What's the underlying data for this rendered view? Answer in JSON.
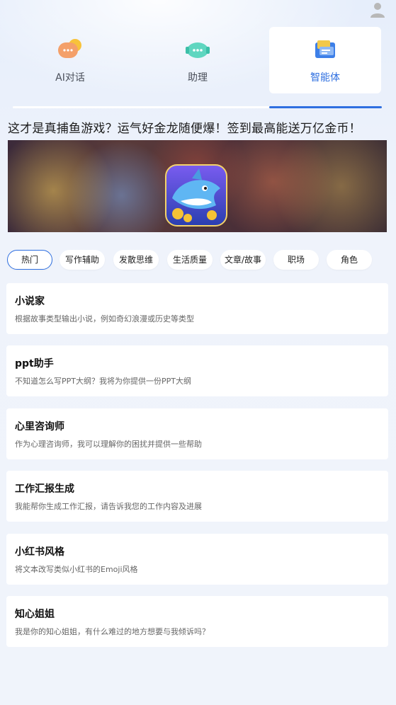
{
  "tabs": [
    {
      "label": "AI对话",
      "icon": "chat-bubble-icon",
      "active": false
    },
    {
      "label": "助理",
      "icon": "assistant-robot-icon",
      "active": true
    },
    {
      "label": "智能体",
      "icon": "agent-cube-icon",
      "active": true
    }
  ],
  "banner": {
    "title": "这才是真捕鱼游戏？运气好金龙随便爆！签到最高能送万亿金币！"
  },
  "chips": [
    "热门",
    "写作辅助",
    "发散思维",
    "生活质量",
    "文章/故事",
    "职场",
    "角色"
  ],
  "cards": [
    {
      "title": "小说家",
      "desc": "根据故事类型输出小说，例如奇幻浪漫或历史等类型"
    },
    {
      "title": "ppt助手",
      "desc": "不知道怎么写PPT大纲？我将为你提供一份PPT大纲"
    },
    {
      "title": "心里咨询师",
      "desc": "作为心理咨询师，我可以理解你的困扰并提供一些帮助"
    },
    {
      "title": "工作汇报生成",
      "desc": "我能帮你生成工作汇报，请告诉我您的工作内容及进展"
    },
    {
      "title": "小红书风格",
      "desc": "将文本改写类似小红书的Emoji风格"
    },
    {
      "title": "知心姐姐",
      "desc": "我是你的知心姐姐，有什么难过的地方想要与我倾诉吗？"
    }
  ],
  "colors": {
    "accent": "#2f6fe0",
    "background": "#eef2fa"
  }
}
